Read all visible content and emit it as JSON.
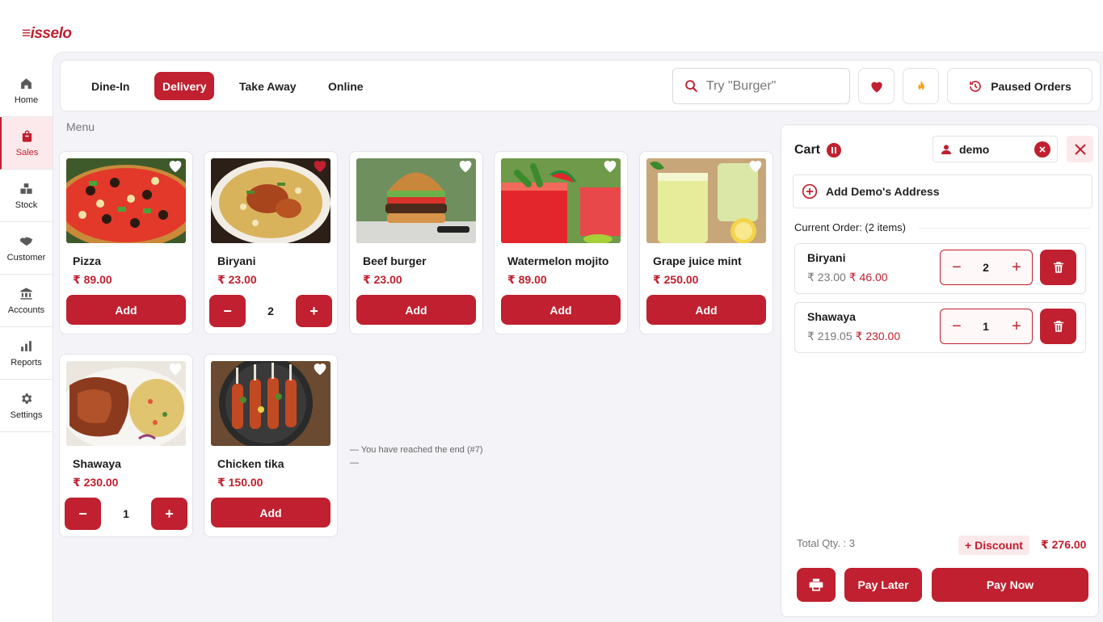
{
  "app": {
    "logo": "≡isselo",
    "accent": "#c0202f"
  },
  "sidebar": {
    "items": [
      {
        "label": "Home",
        "icon": "home-icon"
      },
      {
        "label": "Sales",
        "icon": "shopping-bag-icon",
        "active": true
      },
      {
        "label": "Stock",
        "icon": "boxes-icon"
      },
      {
        "label": "Customer",
        "icon": "handshake-icon"
      },
      {
        "label": "Accounts",
        "icon": "bank-icon"
      },
      {
        "label": "Reports",
        "icon": "bar-chart-icon"
      },
      {
        "label": "Settings",
        "icon": "gear-icon"
      }
    ]
  },
  "header": {
    "tabs": [
      {
        "label": "Dine-In"
      },
      {
        "label": "Delivery",
        "active": true
      },
      {
        "label": "Take Away"
      },
      {
        "label": "Online"
      }
    ],
    "search_placeholder": "Try \"Burger\"",
    "favorites_icon": "heart-icon",
    "trending_icon": "flame-icon",
    "paused_orders_label": "Paused Orders"
  },
  "menu": {
    "label": "Menu",
    "end_message": "— You have reached the end (#7) —",
    "products": [
      {
        "name": "Pizza",
        "price": "₹ 89.00",
        "favorite": false,
        "in_cart": false,
        "add_label": "Add"
      },
      {
        "name": "Biryani",
        "price": "₹ 23.00",
        "favorite": true,
        "in_cart": true,
        "qty": "2"
      },
      {
        "name": "Beef burger",
        "price": "₹ 23.00",
        "favorite": false,
        "in_cart": false,
        "add_label": "Add"
      },
      {
        "name": "Watermelon mojito",
        "price": "₹ 89.00",
        "favorite": false,
        "in_cart": false,
        "add_label": "Add"
      },
      {
        "name": "Grape juice mint",
        "price": "₹ 250.00",
        "favorite": false,
        "in_cart": false,
        "add_label": "Add"
      },
      {
        "name": "Shawaya",
        "price": "₹ 230.00",
        "favorite": false,
        "in_cart": true,
        "qty": "1"
      },
      {
        "name": "Chicken tika",
        "price": "₹ 150.00",
        "favorite": false,
        "in_cart": false,
        "add_label": "Add"
      }
    ]
  },
  "cart": {
    "title": "Cart",
    "customer": "demo",
    "address_label": "Add Demo's Address",
    "current_order": "Current Order: (2 items)",
    "items": [
      {
        "name": "Biryani",
        "unit_price": "₹ 23.00",
        "total": "₹ 46.00",
        "qty": "2"
      },
      {
        "name": "Shawaya",
        "unit_price": "₹ 219.05",
        "total": "₹ 230.00",
        "qty": "1"
      }
    ],
    "total_qty": "Total Qty. : 3",
    "discount_label": "+ Discount",
    "grand_total": "₹ 276.00",
    "pay_later_label": "Pay Later",
    "pay_now_label": "Pay Now"
  }
}
